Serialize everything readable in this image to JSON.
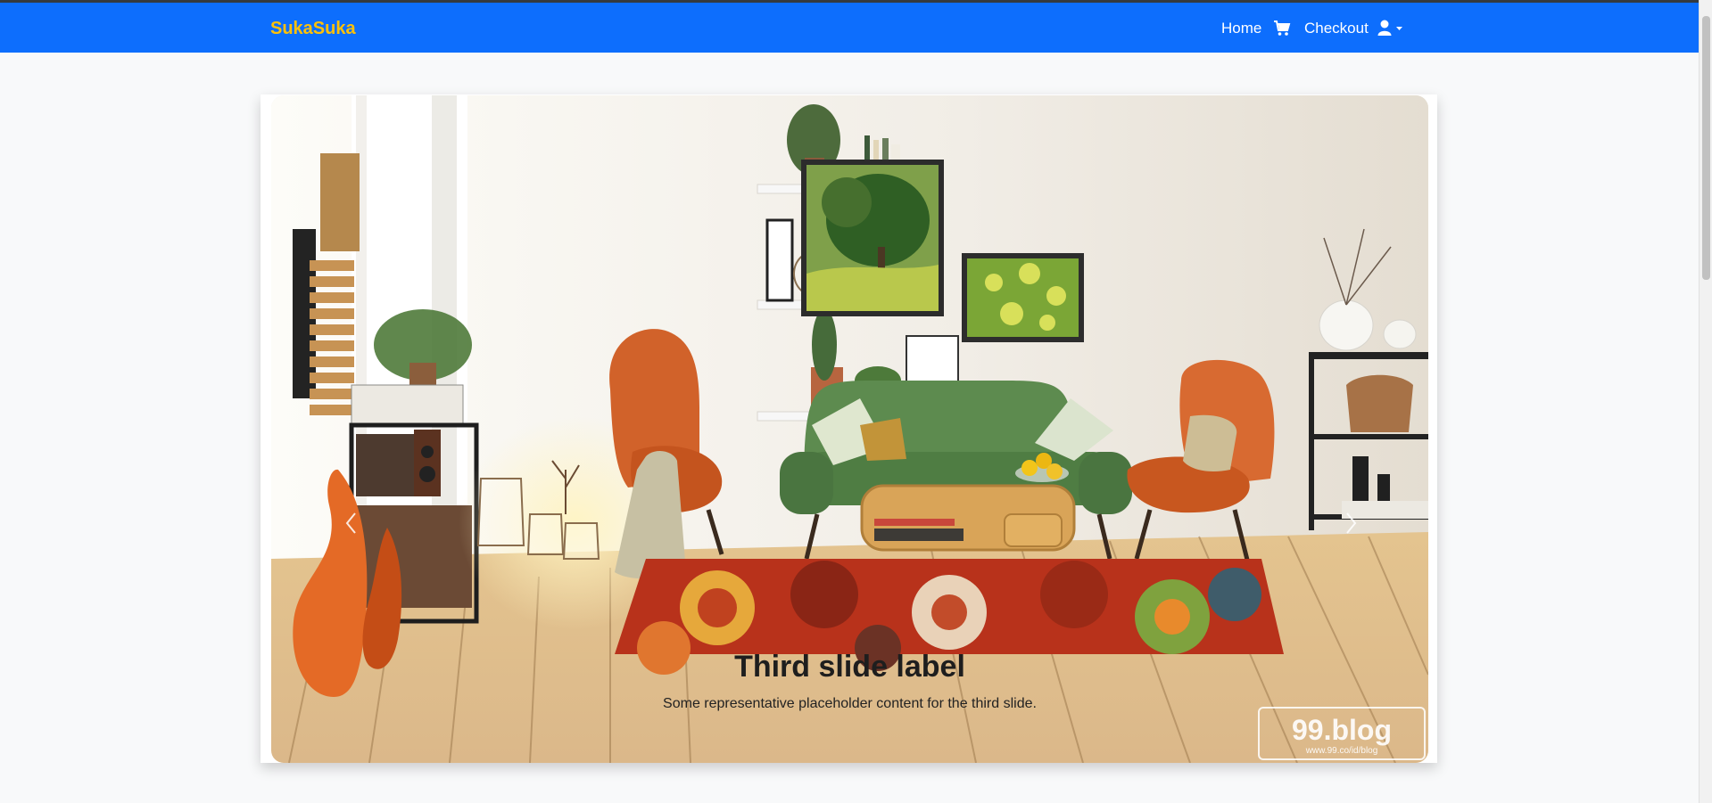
{
  "navbar": {
    "brand": "SukaSuka",
    "home_label": "Home",
    "checkout_label": "Checkout",
    "cart_icon": "cart-icon",
    "user_icon": "user-icon",
    "dropdown_icon": "caret-down-icon"
  },
  "carousel": {
    "slide": {
      "title": "Third slide label",
      "caption": "Some representative placeholder content for the third slide."
    },
    "watermark": {
      "main": "99.blog",
      "sub": "www.99.co/id/blog"
    },
    "prev_icon": "chevron-left-icon",
    "next_icon": "chevron-right-icon"
  },
  "colors": {
    "navbar": "#0d6efd",
    "brand": "#ffc107",
    "page_background": "#f8f9fa"
  }
}
